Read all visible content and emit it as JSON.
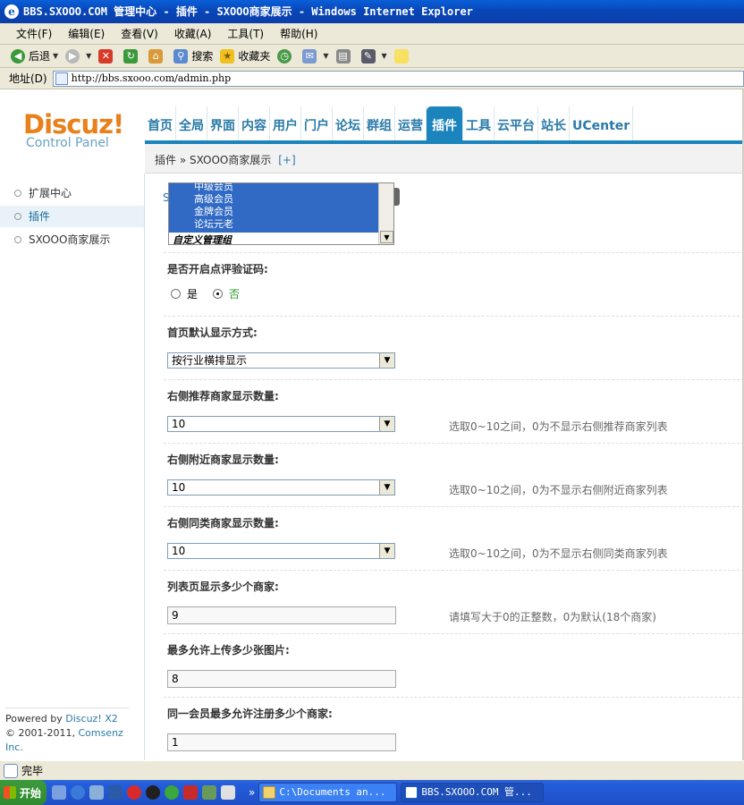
{
  "window": {
    "title": "BBS.SXOOO.COM 管理中心 - 插件 - SXOOO商家展示 - Windows Internet Explorer",
    "status": "完毕"
  },
  "menubar": [
    "文件(F)",
    "编辑(E)",
    "查看(V)",
    "收藏(A)",
    "工具(T)",
    "帮助(H)"
  ],
  "toolbar": {
    "back": "后退",
    "search": "搜索",
    "favorites": "收藏夹"
  },
  "address": {
    "label": "地址(D)",
    "url": "http://bbs.sxooo.com/admin.php"
  },
  "header": {
    "logo_main": "Discuz!",
    "logo_sub": "Control Panel",
    "nav": [
      "首页",
      "全局",
      "界面",
      "内容",
      "用户",
      "门户",
      "论坛",
      "群组",
      "运营",
      "插件",
      "工具",
      "云平台",
      "站长",
      "UCenter"
    ],
    "active_nav": "插件",
    "breadcrumb": "插件 » SXOOO商家展示",
    "breadcrumb_add": "[+]"
  },
  "sidebar": {
    "items": [
      "扩展中心",
      "插件",
      "SXOOO商家展示"
    ],
    "powered_line1_prefix": "Powered by ",
    "powered_line1_link": "Discuz! X2",
    "powered_line2_prefix": "© 2001-2011, ",
    "powered_line2_link": "Comsenz Inc."
  },
  "form": {
    "partial_label": "S",
    "listbox_options": [
      "中级会员",
      "高级会员",
      "金牌会员",
      "论坛元老"
    ],
    "listbox_group": "自定义管理组",
    "captcha": {
      "label": "是否开启点评验证码:",
      "yes": "是",
      "no": "否",
      "selected": "否"
    },
    "home_display": {
      "label": "首页默认显示方式:",
      "value": "按行业横排显示"
    },
    "right_recommend": {
      "label": "右侧推荐商家显示数量:",
      "value": "10",
      "hint": "选取0~10之间，0为不显示右侧推荐商家列表"
    },
    "right_nearby": {
      "label": "右侧附近商家显示数量:",
      "value": "10",
      "hint": "选取0~10之间，0为不显示右侧附近商家列表"
    },
    "right_similar": {
      "label": "右侧同类商家显示数量:",
      "value": "10",
      "hint": "选取0~10之间，0为不显示右侧同类商家列表"
    },
    "list_count": {
      "label": "列表页显示多少个商家:",
      "value": "9",
      "hint": "请填写大于0的正整数，0为默认(18个商家)"
    },
    "max_images": {
      "label": "最多允许上传多少张图片:",
      "value": "8"
    },
    "max_register": {
      "label": "同一会员最多允许注册多少个商家:",
      "value": "1"
    }
  },
  "taskbar": {
    "start": "开始",
    "tasks": [
      "C:\\Documents an...",
      "BBS.SXOOO.COM 管..."
    ]
  }
}
